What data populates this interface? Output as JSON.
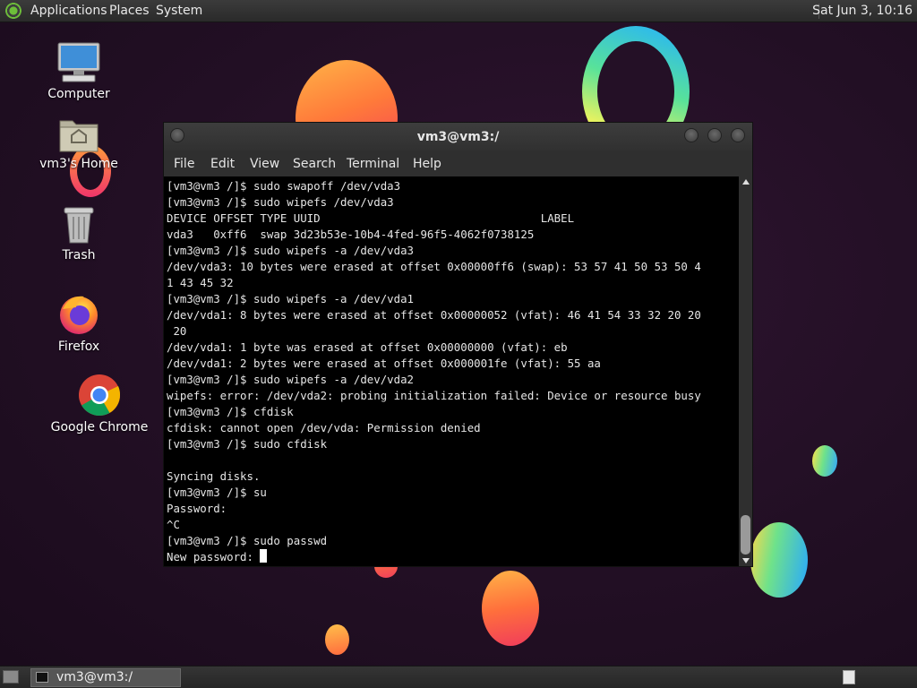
{
  "top_panel": {
    "menus": [
      "Applications",
      "Places",
      "System"
    ],
    "clock": "Sat Jun  3, 10:16"
  },
  "desktop_icons": [
    {
      "label": "Computer",
      "icon": "computer-icon"
    },
    {
      "label": "vm3's Home",
      "icon": "home-folder-icon"
    },
    {
      "label": "Trash",
      "icon": "trash-icon"
    },
    {
      "label": "Firefox",
      "icon": "firefox-icon"
    },
    {
      "label": "Google Chrome",
      "icon": "chrome-icon"
    }
  ],
  "terminal": {
    "title": "vm3@vm3:/",
    "menu": [
      "File",
      "Edit",
      "View",
      "Search",
      "Terminal",
      "Help"
    ],
    "lines": [
      "[vm3@vm3 /]$ sudo swapoff /dev/vda3",
      "[vm3@vm3 /]$ sudo wipefs /dev/vda3",
      "DEVICE OFFSET TYPE UUID                                 LABEL",
      "vda3   0xff6  swap 3d23b53e-10b4-4fed-96f5-4062f0738125",
      "[vm3@vm3 /]$ sudo wipefs -a /dev/vda3",
      "/dev/vda3: 10 bytes were erased at offset 0x00000ff6 (swap): 53 57 41 50 53 50 4",
      "1 43 45 32",
      "[vm3@vm3 /]$ sudo wipefs -a /dev/vda1",
      "/dev/vda1: 8 bytes were erased at offset 0x00000052 (vfat): 46 41 54 33 32 20 20",
      " 20",
      "/dev/vda1: 1 byte was erased at offset 0x00000000 (vfat): eb",
      "/dev/vda1: 2 bytes were erased at offset 0x000001fe (vfat): 55 aa",
      "[vm3@vm3 /]$ sudo wipefs -a /dev/vda2",
      "wipefs: error: /dev/vda2: probing initialization failed: Device or resource busy",
      "[vm3@vm3 /]$ cfdisk",
      "cfdisk: cannot open /dev/vda: Permission denied",
      "[vm3@vm3 /]$ sudo cfdisk",
      "",
      "Syncing disks.",
      "[vm3@vm3 /]$ su",
      "Password:",
      "^C",
      "[vm3@vm3 /]$ sudo passwd"
    ],
    "prompt": "New password: "
  },
  "taskbar": {
    "task_label": "vm3@vm3:/"
  }
}
